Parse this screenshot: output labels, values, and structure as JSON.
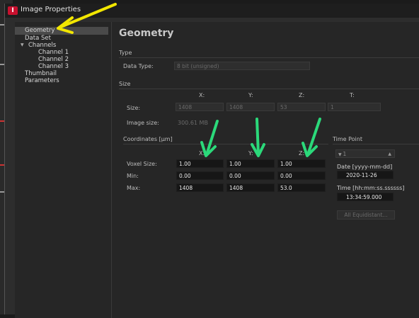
{
  "window": {
    "title": "Image Properties",
    "icon_letter": "I"
  },
  "tree": {
    "items": [
      {
        "label": "Geometry",
        "selected": true
      },
      {
        "label": "Data Set"
      },
      {
        "label": "Channels",
        "expanded": true
      },
      {
        "label": "Channel 1"
      },
      {
        "label": "Channel 2"
      },
      {
        "label": "Channel 3"
      },
      {
        "label": "Thumbnail"
      },
      {
        "label": "Parameters"
      }
    ]
  },
  "main": {
    "title": "Geometry",
    "type_section": {
      "heading": "Type",
      "data_type_label": "Data Type:",
      "data_type_value": "8 bit (unsigned)"
    },
    "size_section": {
      "heading": "Size",
      "columns": [
        "X:",
        "Y:",
        "Z:",
        "T:"
      ],
      "size_label": "Size:",
      "values": [
        "1408",
        "1408",
        "53",
        "1"
      ],
      "image_size_label": "Image size:",
      "image_size_value": "300.61 MB"
    },
    "coords_section": {
      "heading": "Coordinates [µm]",
      "columns": [
        "X:",
        "Y:",
        "Z:"
      ],
      "rows": [
        {
          "label": "Voxel Size:",
          "values": [
            "1.00",
            "1.00",
            "1.00"
          ]
        },
        {
          "label": "Min:",
          "values": [
            "0.00",
            "0.00",
            "0.00"
          ]
        },
        {
          "label": "Max:",
          "values": [
            "1408",
            "1408",
            "53.0"
          ]
        }
      ]
    },
    "time_point": {
      "heading": "Time Point",
      "spinner_value": "1",
      "date_label": "Date [yyyy-mm-dd]",
      "date_value": "2020-11-26",
      "time_label": "Time [hh:mm:ss.ssssss]",
      "time_value": "13:34:59.000",
      "all_equidistant_label": "All Equidistant..."
    }
  },
  "annotations": {
    "yellow": "#f2e600",
    "green": "#2bd97a"
  }
}
